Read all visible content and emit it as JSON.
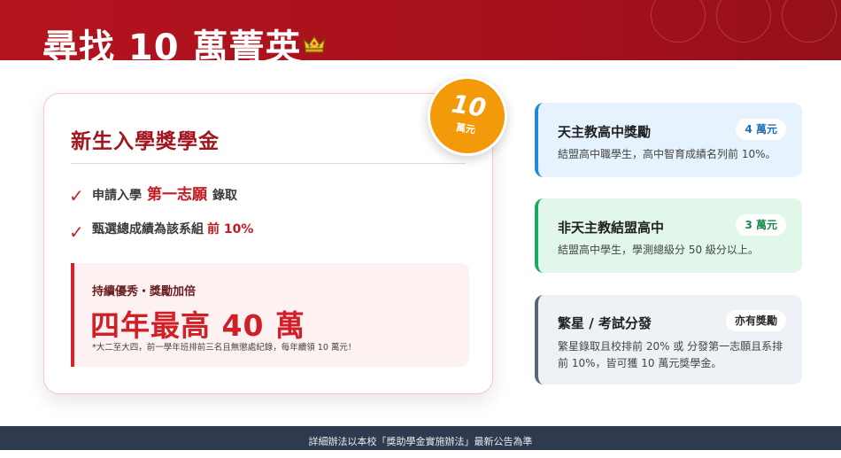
{
  "header": {
    "title": "尋找 10 萬菁英",
    "icon": "crown-icon",
    "colors": {
      "banner": "#b3141e"
    }
  },
  "main_card": {
    "title": "新生入學獎學金",
    "checks": [
      {
        "prefix": "申請入學",
        "highlight": "第一志願",
        "suffix": "錄取"
      },
      {
        "prefix": "甄選總成績為該系組",
        "highlight": "前 10%",
        "suffix": ""
      }
    ],
    "highlight_box": {
      "label": "持續優秀・獎勵加倍",
      "big_text": "四年最高 40 萬",
      "note": "*大二至大四，前一學年班排前三名且無懲處紀錄，每年續領 10 萬元！"
    }
  },
  "badge": {
    "number": "10",
    "unit": "萬元",
    "color": "#f39a0b"
  },
  "side_cards": [
    {
      "title": "天主教高中獎勵",
      "pill": "4 萬元",
      "description": "結盟高中職學生，高中智育成績名列前 10%。",
      "accent": "#1f8ad6"
    },
    {
      "title": "非天主教結盟高中",
      "pill": "3 萬元",
      "description": "結盟高中學生，學測總級分 50 級分以上。",
      "accent": "#1aa864"
    },
    {
      "title": "繁星 / 考試分發",
      "pill": "亦有獎勵",
      "description": "繁星錄取且校排前 20% 或 分發第一志願且系排前 10%，皆可獲 10 萬元獎學金。",
      "accent": "#5b6778"
    }
  ],
  "footer": {
    "text": "詳細辦法以本校「獎助學金實施辦法」最新公告為準"
  }
}
